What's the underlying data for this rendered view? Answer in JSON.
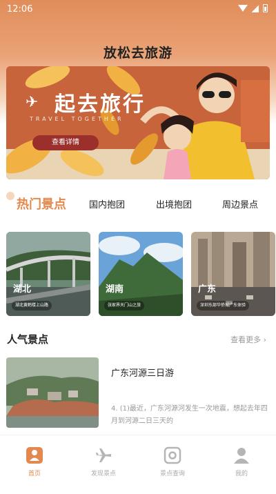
{
  "status_bar": {
    "time": "12:06"
  },
  "app_title": "放松去旅游",
  "banner": {
    "title": "起去旅行",
    "subtitle": "TRAVEL TOGETHER",
    "button_label": "查看详情"
  },
  "tabs": [
    {
      "label": "热门景点",
      "active": true
    },
    {
      "label": "国内抱团",
      "active": false
    },
    {
      "label": "出境抱团",
      "active": false
    },
    {
      "label": "周边景点",
      "active": false
    }
  ],
  "cards": [
    {
      "name": "湖北",
      "desc": "湖北黄鹤楼上山路"
    },
    {
      "name": "湖南",
      "desc": "张家界天门山之旅"
    },
    {
      "name": "广东",
      "desc": "深圳东部华侨城广东体验"
    }
  ],
  "section": {
    "title": "人气景点",
    "more": "查看更多 ›"
  },
  "feature": {
    "title": "广东河源三日游",
    "desc": "4. (1)最近，广东河源河发生一次地震，想起去年四月到河源二日三天的"
  },
  "tabbar": [
    {
      "label": "首页",
      "icon": "home-icon",
      "active": true
    },
    {
      "label": "发现景点",
      "icon": "plane-icon",
      "active": false
    },
    {
      "label": "景点查询",
      "icon": "target-icon",
      "active": false
    },
    {
      "label": "我的",
      "icon": "user-icon",
      "active": false
    }
  ],
  "colors": {
    "accent": "#e3894d",
    "header_top": "#e08d5a",
    "banner_button": "#9b2f2b"
  }
}
